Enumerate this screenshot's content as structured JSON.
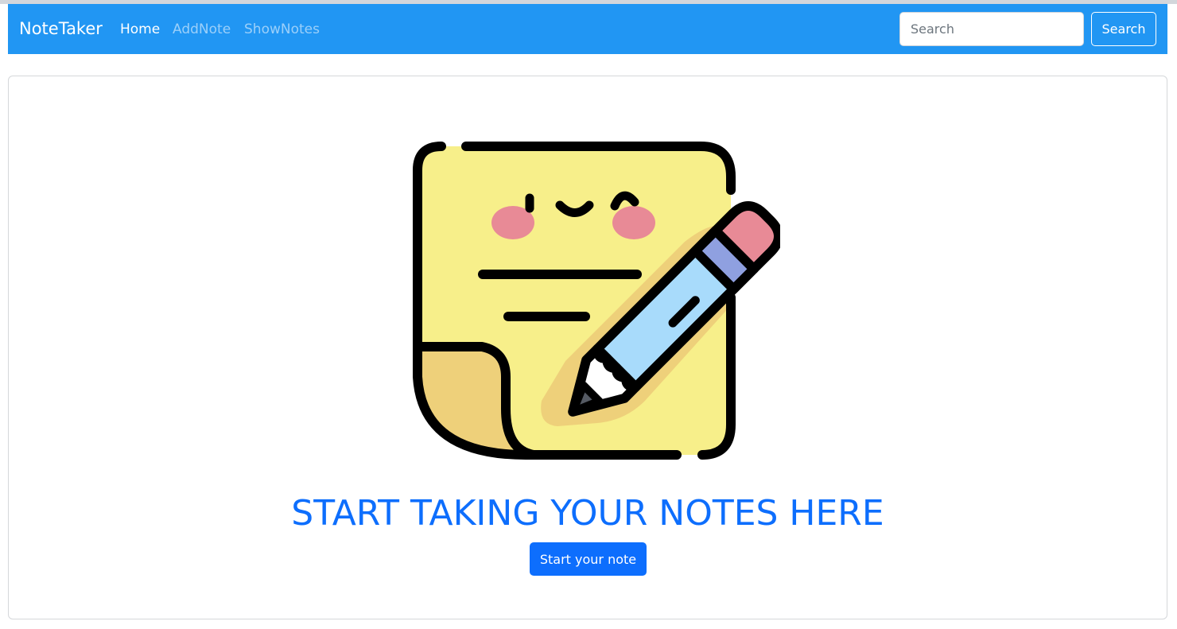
{
  "navbar": {
    "brand": "NoteTaker",
    "links": [
      {
        "label": "Home",
        "active": true
      },
      {
        "label": "AddNote",
        "active": false
      },
      {
        "label": "ShowNotes",
        "active": false
      }
    ],
    "search": {
      "placeholder": "Search",
      "value": "",
      "button_label": "Search"
    },
    "background_color": "#2196f3"
  },
  "main": {
    "illustration_icon": "sticky-note-with-pencil-icon",
    "title": "START TAKING YOUR NOTES HERE",
    "button_label": "Start your note",
    "accent_color": "#0d6efd"
  }
}
